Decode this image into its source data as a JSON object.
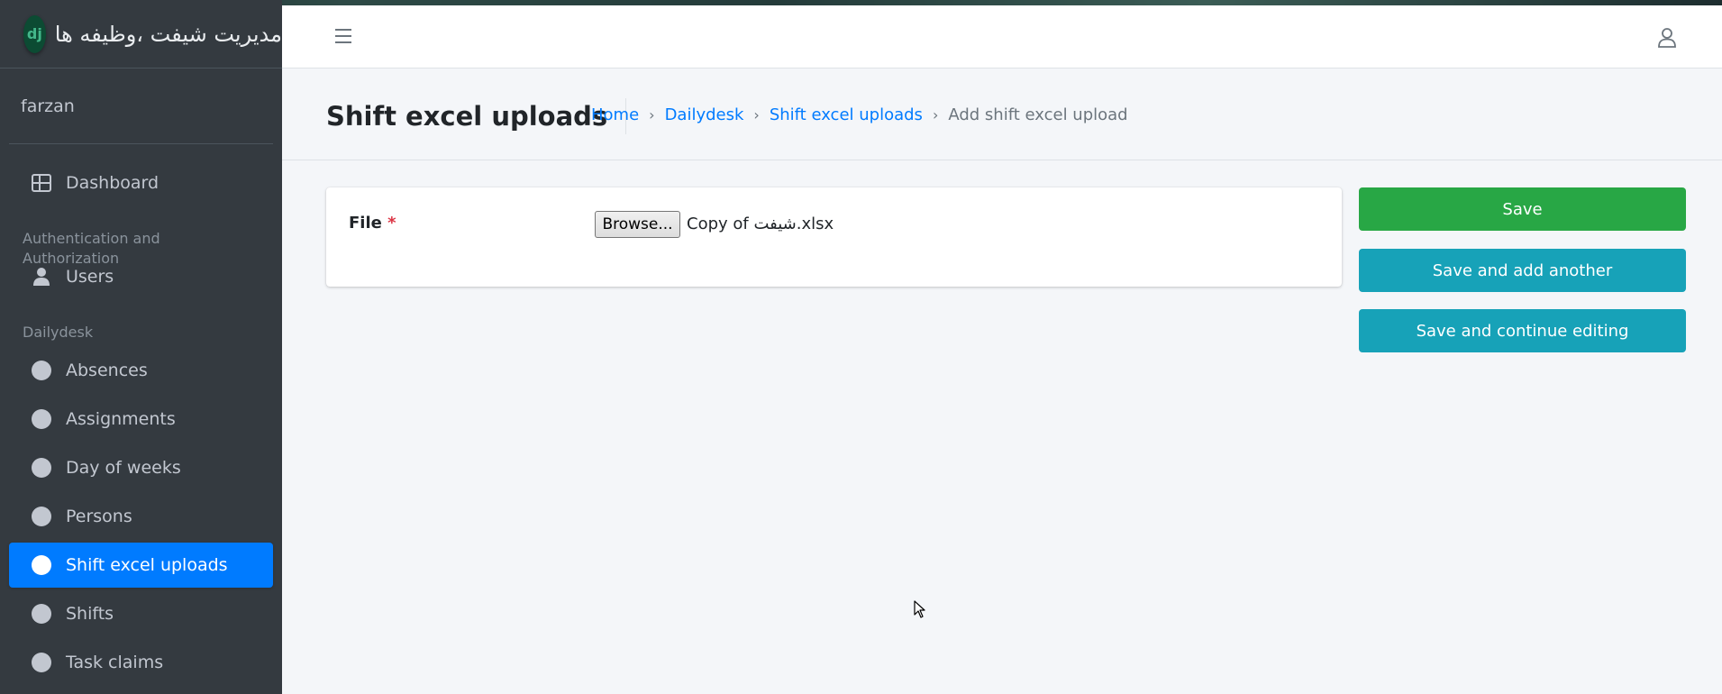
{
  "brand": {
    "logo_text": "dj",
    "title": "مدیریت شیفت ،وظیفه ها"
  },
  "user": {
    "name": "farzan"
  },
  "sidebar": {
    "dashboard": "Dashboard",
    "section_auth": "Authentication and Authorization",
    "users": "Users",
    "section_app": "Dailydesk",
    "items": [
      {
        "label": "Absences",
        "active": false
      },
      {
        "label": "Assignments",
        "active": false
      },
      {
        "label": "Day of weeks",
        "active": false
      },
      {
        "label": "Persons",
        "active": false
      },
      {
        "label": "Shift excel uploads",
        "active": true
      },
      {
        "label": "Shifts",
        "active": false
      },
      {
        "label": "Task claims",
        "active": false
      }
    ]
  },
  "header": {
    "title": "Shift excel uploads",
    "breadcrumb": [
      "Home",
      "Dailydesk",
      "Shift excel uploads",
      "Add shift excel upload"
    ],
    "separator": "›"
  },
  "form": {
    "file_label": "File",
    "required_mark": "*",
    "browse_label": "Browse...",
    "file_name": "Copy of شیفت.xlsx"
  },
  "actions": {
    "save": "Save",
    "save_add": "Save and add another",
    "save_continue": "Save and continue editing"
  },
  "colors": {
    "sidebar_bg": "#343a40",
    "active_bg": "#007bff",
    "save_green": "#28a745",
    "info_teal": "#17a2b8",
    "link_blue": "#007bff"
  },
  "icons": [
    "menu-icon",
    "user-icon",
    "dashboard-icon",
    "person-icon",
    "circle-icon"
  ]
}
